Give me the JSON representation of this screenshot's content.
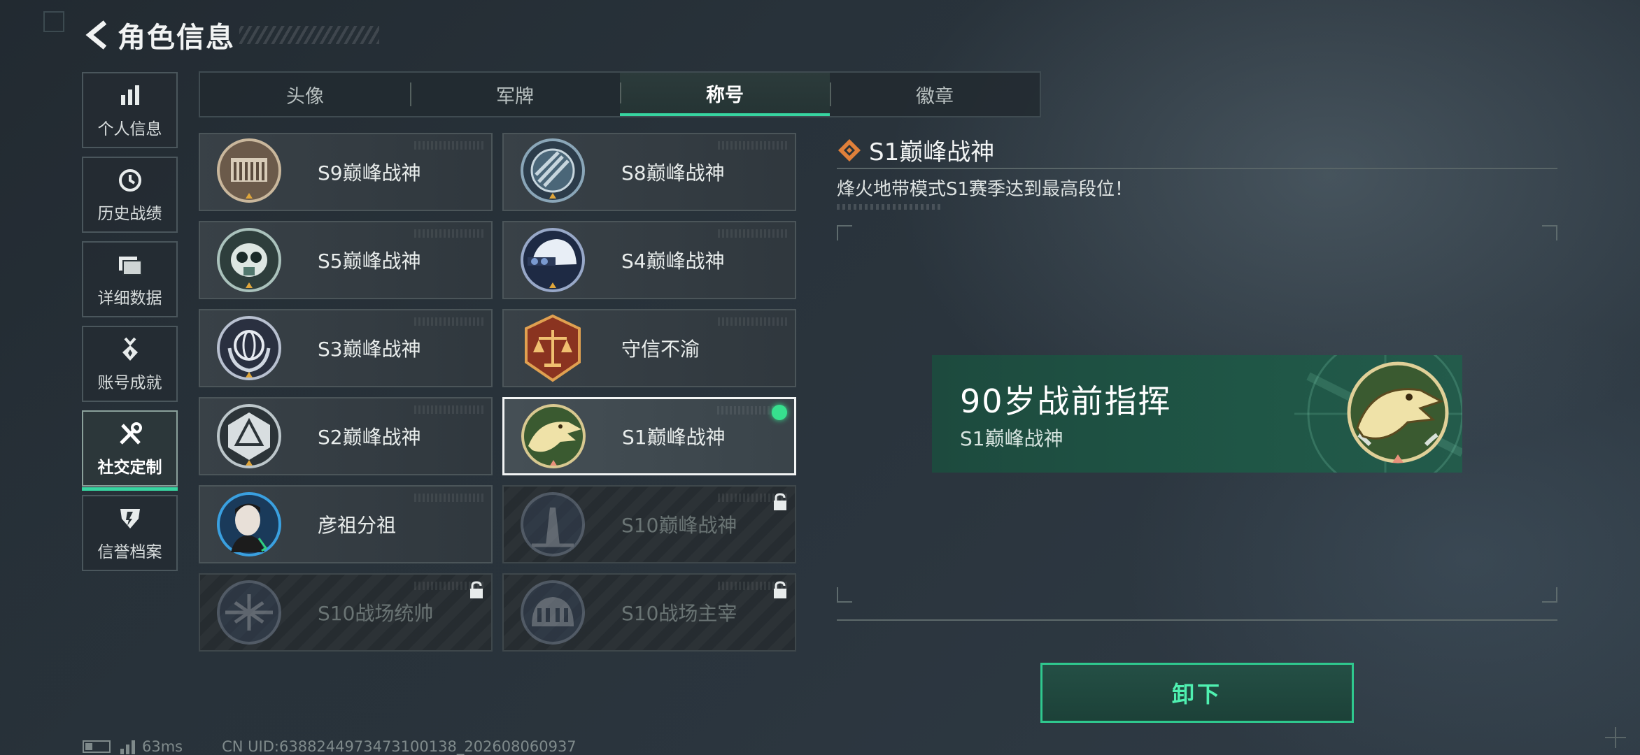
{
  "header": {
    "title": "角色信息"
  },
  "left_nav": {
    "items": [
      {
        "label": "个人信息",
        "icon": "bar-chart-icon"
      },
      {
        "label": "历史战绩",
        "icon": "history-clock-icon"
      },
      {
        "label": "详细数据",
        "icon": "folder-icon"
      },
      {
        "label": "账号成就",
        "icon": "medal-icon"
      },
      {
        "label": "社交定制",
        "icon": "tools-icon",
        "active": true
      },
      {
        "label": "信誉档案",
        "icon": "shield-badge-icon"
      }
    ]
  },
  "tabs": [
    {
      "label": "头像"
    },
    {
      "label": "军牌"
    },
    {
      "label": "称号",
      "active": true
    },
    {
      "label": "徽章"
    }
  ],
  "titles": [
    {
      "label": "S9巅峰战神",
      "emblem": "fortress-emblem",
      "state": "owned"
    },
    {
      "label": "S8巅峰战神",
      "emblem": "striped-globe-emblem",
      "state": "owned"
    },
    {
      "label": "S5巅峰战神",
      "emblem": "gas-mask-skull-emblem",
      "state": "owned"
    },
    {
      "label": "S4巅峰战神",
      "emblem": "helmet-emblem",
      "state": "owned"
    },
    {
      "label": "S3巅峰战神",
      "emblem": "globe-laurel-emblem",
      "state": "owned"
    },
    {
      "label": "守信不渝",
      "emblem": "scales-emblem",
      "state": "owned"
    },
    {
      "label": "S2巅峰战神",
      "emblem": "triangle-shield-emblem",
      "state": "owned"
    },
    {
      "label": "S1巅峰战神",
      "emblem": "crocodile-emblem",
      "state": "selected-equipped"
    },
    {
      "label": "彦祖分祖",
      "emblem": "portrait-emblem",
      "state": "owned"
    },
    {
      "label": "S10巅峰战神",
      "emblem": "tower-emblem",
      "state": "locked"
    },
    {
      "label": "S10战场统帅",
      "emblem": "aircraft-emblem",
      "state": "locked"
    },
    {
      "label": "S10战场主宰",
      "emblem": "colosseum-emblem",
      "state": "locked"
    }
  ],
  "detail": {
    "title": "S1巅峰战神",
    "description": "烽火地带模式S1赛季达到最高段位！"
  },
  "preview": {
    "player_name": "90岁战前指挥",
    "title": "S1巅峰战神"
  },
  "action": {
    "label": "卸下"
  },
  "status": {
    "ping": "63ms",
    "uid": "CN UID:6388244973473100138_202608060937"
  },
  "colors": {
    "accent": "#37d4a0",
    "equipped_dot": "#37e08e",
    "preview_bg": "#1f5646",
    "detail_diamond": "#e0803a"
  }
}
